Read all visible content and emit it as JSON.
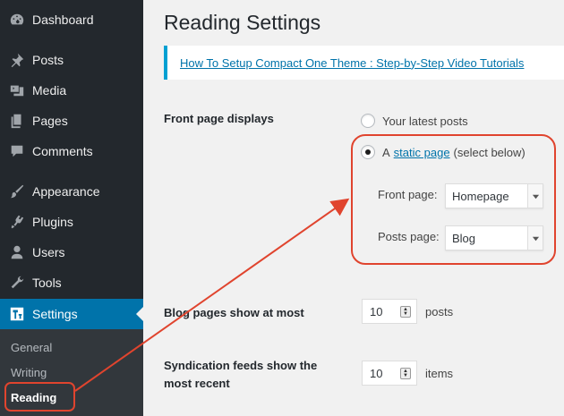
{
  "sidebar": {
    "items": [
      {
        "label": "Dashboard",
        "icon": "dashboard-icon"
      },
      {
        "label": "Posts",
        "icon": "pin-icon"
      },
      {
        "label": "Media",
        "icon": "media-icon"
      },
      {
        "label": "Pages",
        "icon": "pages-icon"
      },
      {
        "label": "Comments",
        "icon": "comments-icon"
      },
      {
        "label": "Appearance",
        "icon": "brush-icon"
      },
      {
        "label": "Plugins",
        "icon": "plugin-icon"
      },
      {
        "label": "Users",
        "icon": "user-icon"
      },
      {
        "label": "Tools",
        "icon": "wrench-icon"
      },
      {
        "label": "Settings",
        "icon": "settings-icon"
      }
    ],
    "submenu": [
      "General",
      "Writing",
      "Reading"
    ]
  },
  "page": {
    "title": "Reading Settings",
    "notice_link": "How To Setup Compact One Theme : Step-by-Step Video Tutorials"
  },
  "front_page": {
    "label": "Front page displays",
    "option_latest": "Your latest posts",
    "option_static_prefix": "A",
    "option_static_link": "static page",
    "option_static_suffix": "(select below)",
    "front_page_label": "Front page:",
    "front_page_value": "Homepage",
    "posts_page_label": "Posts page:",
    "posts_page_value": "Blog",
    "selected": "static"
  },
  "blog_pages": {
    "label": "Blog pages show at most",
    "value": "10",
    "unit": "posts"
  },
  "syndication": {
    "label_line1": "Syndication feeds show the",
    "label_line2": "most recent",
    "value": "10",
    "unit": "items"
  },
  "colors": {
    "sidebar_bg": "#23282d",
    "active_bg": "#0073aa",
    "annotation_red": "#e0442e",
    "link_blue": "#0073aa"
  }
}
